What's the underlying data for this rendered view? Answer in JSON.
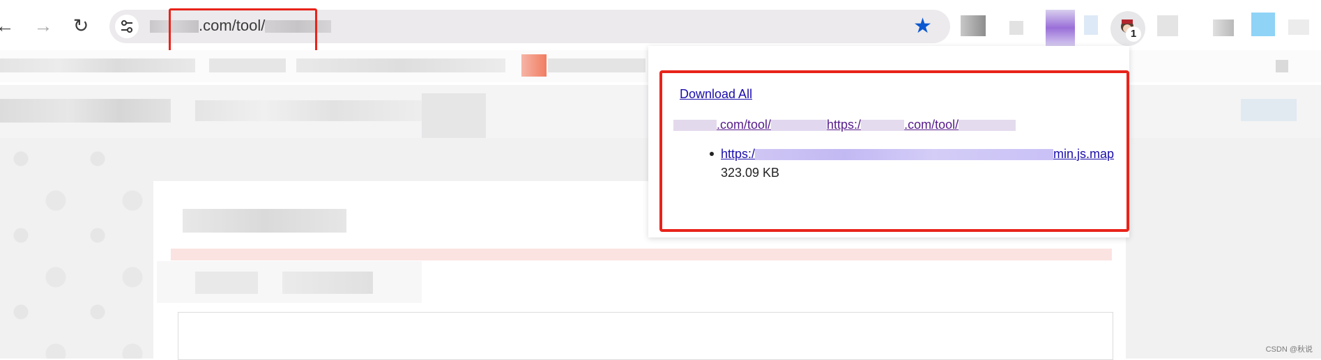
{
  "browser": {
    "back_glyph": "←",
    "forward_glyph": "→",
    "reload_glyph": "↻",
    "site_info_glyph": "⚙",
    "url_visible": ".com/tool/",
    "bookmark_star_glyph": "★",
    "profile_badge": "1",
    "colors": {
      "star": "#0b57d0",
      "highlight": "#e8231a"
    }
  },
  "popup": {
    "download_all_label": "Download All",
    "page_url_part1": ".com/tool/",
    "page_url_part2": "https:/",
    "page_url_part3": ".com/tool/",
    "files": [
      {
        "link_start": "https:/",
        "link_end": "min.js.map",
        "size": "323.09 KB"
      }
    ]
  },
  "watermark": "CSDN @秋说"
}
